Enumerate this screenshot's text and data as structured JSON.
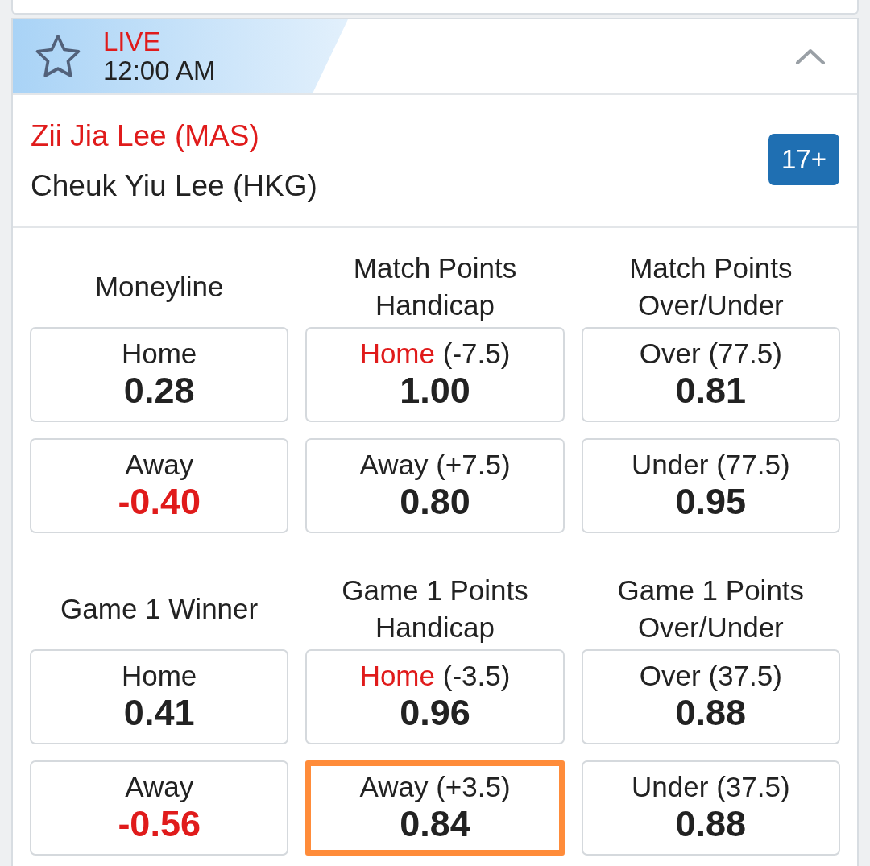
{
  "event": {
    "status": "LIVE",
    "time": "12:00 AM",
    "favorite": false,
    "expanded": true,
    "teams": [
      {
        "name": "Zii Jia Lee (MAS)",
        "favored": true
      },
      {
        "name": "Cheuk Yiu Lee (HKG)",
        "favored": false
      }
    ],
    "more_markets": "17+",
    "market_groups": [
      {
        "markets": [
          {
            "title": "Moneyline",
            "selections": [
              {
                "label": "Home",
                "favored": false,
                "odds": "0.28",
                "negative": false,
                "selected": false
              },
              {
                "label": "Away",
                "favored": false,
                "odds": "-0.40",
                "negative": true,
                "selected": false
              }
            ]
          },
          {
            "title": "Match Points Handicap",
            "selections": [
              {
                "label": "Home",
                "favored": true,
                "line": "(-7.5)",
                "odds": "1.00",
                "negative": false,
                "selected": false
              },
              {
                "label": "Away",
                "favored": false,
                "line": "(+7.5)",
                "odds": "0.80",
                "negative": false,
                "selected": false
              }
            ]
          },
          {
            "title": "Match Points Over/Under",
            "selections": [
              {
                "label": "Over",
                "favored": false,
                "line": "(77.5)",
                "odds": "0.81",
                "negative": false,
                "selected": false
              },
              {
                "label": "Under",
                "favored": false,
                "line": "(77.5)",
                "odds": "0.95",
                "negative": false,
                "selected": false
              }
            ]
          }
        ]
      },
      {
        "markets": [
          {
            "title": "Game 1 Winner",
            "selections": [
              {
                "label": "Home",
                "favored": false,
                "odds": "0.41",
                "negative": false,
                "selected": false
              },
              {
                "label": "Away",
                "favored": false,
                "odds": "-0.56",
                "negative": true,
                "selected": false
              }
            ]
          },
          {
            "title": "Game 1 Points Handicap",
            "selections": [
              {
                "label": "Home",
                "favored": true,
                "line": "(-3.5)",
                "odds": "0.96",
                "negative": false,
                "selected": false
              },
              {
                "label": "Away",
                "favored": false,
                "line": "(+3.5)",
                "odds": "0.84",
                "negative": false,
                "selected": true
              }
            ]
          },
          {
            "title": "Game 1 Points Over/Under",
            "selections": [
              {
                "label": "Over",
                "favored": false,
                "line": "(37.5)",
                "odds": "0.88",
                "negative": false,
                "selected": false
              },
              {
                "label": "Under",
                "favored": false,
                "line": "(37.5)",
                "odds": "0.88",
                "negative": false,
                "selected": false
              }
            ]
          }
        ]
      }
    ]
  }
}
